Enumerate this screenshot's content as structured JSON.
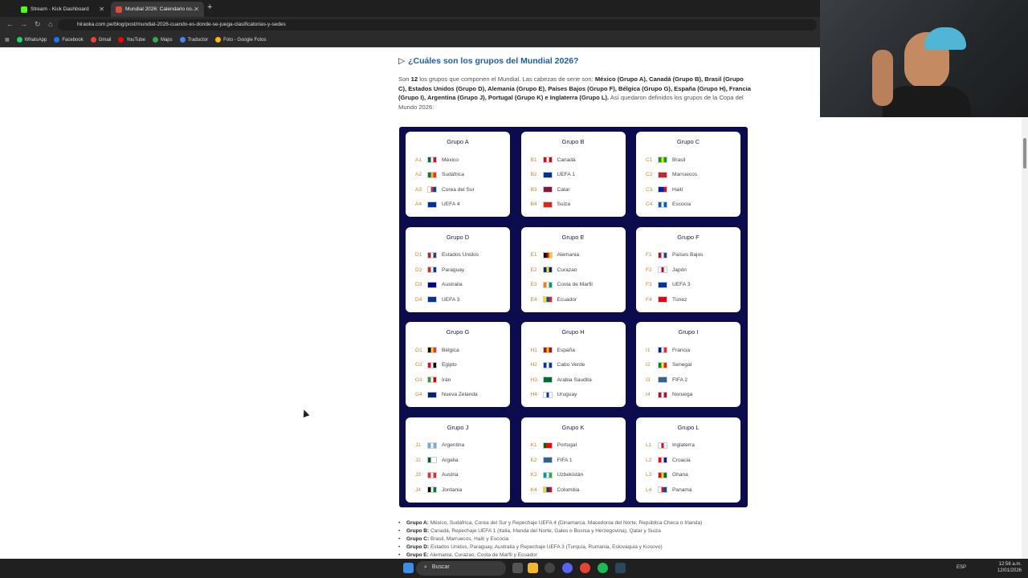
{
  "browser": {
    "tabs": [
      {
        "label": "Stream - Kick Dashboard",
        "active": false,
        "icon": "kick-icon",
        "color": "#53fc18"
      },
      {
        "label": "Mundial 2026: Calendario co...",
        "active": true,
        "icon": "hiraoka-icon",
        "color": "#e04a3b"
      }
    ],
    "new_tab": "+",
    "url": "hiraoka.com.pe/blog/post/mundial-2026-cuando-es-donde-se-juega-clasificatorias-y-sedes",
    "bookmarks": [
      {
        "label": "WhatsApp",
        "color": "#25d366"
      },
      {
        "label": "Facebook",
        "color": "#1877f2"
      },
      {
        "label": "Gmail",
        "color": "#ea4335"
      },
      {
        "label": "YouTube",
        "color": "#ff0000"
      },
      {
        "label": "Maps",
        "color": "#34a853"
      },
      {
        "label": "Traductor",
        "color": "#4285f4"
      },
      {
        "label": "Foto - Google Fotos",
        "color": "#fbbc04"
      }
    ]
  },
  "article": {
    "heading": "¿Cuáles son los grupos del Mundial 2026?",
    "intro": {
      "p1": "Son ",
      "n": "12",
      "p2": " los grupos que componen el Mundial. Las cabezas de serie son: ",
      "seeds": "México (Grupo A), Canadá (Grupo B), Brasil (Grupo C), Estados Unidos (Grupo D), Alemania (Grupo E), Países Bajos (Grupo F), Bélgica (Grupo G), España (Grupo H), Francia (Grupo I), Argentina (Grupo J), Portugal (Grupo K) e Inglaterra (Grupo L).",
      "p3": " Así quedaron definidos los grupos de la Copa del Mundo 2026:"
    },
    "groups": [
      {
        "name": "Grupo A",
        "teams": [
          [
            "A1",
            "México"
          ],
          [
            "A2",
            "Sudáfrica"
          ],
          [
            "A3",
            "Corea del Sur"
          ],
          [
            "A4",
            "UEFA 4"
          ]
        ]
      },
      {
        "name": "Grupo B",
        "teams": [
          [
            "B1",
            "Canadá"
          ],
          [
            "B2",
            "UEFA 1"
          ],
          [
            "B3",
            "Catar"
          ],
          [
            "B4",
            "Suiza"
          ]
        ]
      },
      {
        "name": "Grupo C",
        "teams": [
          [
            "C1",
            "Brasil"
          ],
          [
            "C2",
            "Marruecos"
          ],
          [
            "C3",
            "Haití"
          ],
          [
            "C4",
            "Escocia"
          ]
        ]
      },
      {
        "name": "Grupo D",
        "teams": [
          [
            "D1",
            "Estados Unidos"
          ],
          [
            "D2",
            "Paraguay"
          ],
          [
            "D3",
            "Australia"
          ],
          [
            "D4",
            "UEFA 3"
          ]
        ]
      },
      {
        "name": "Grupo E",
        "teams": [
          [
            "E1",
            "Alemania"
          ],
          [
            "E2",
            "Curazao"
          ],
          [
            "E3",
            "Costa de Marfil"
          ],
          [
            "E4",
            "Ecuador"
          ]
        ]
      },
      {
        "name": "Grupo F",
        "teams": [
          [
            "F1",
            "Países Bajos"
          ],
          [
            "F2",
            "Japón"
          ],
          [
            "F3",
            "UEFA 3"
          ],
          [
            "F4",
            "Túnez"
          ]
        ]
      },
      {
        "name": "Grupo G",
        "teams": [
          [
            "G1",
            "Bélgica"
          ],
          [
            "G2",
            "Egipto"
          ],
          [
            "G3",
            "Irán"
          ],
          [
            "G4",
            "Nueva Zelanda"
          ]
        ]
      },
      {
        "name": "Grupo H",
        "teams": [
          [
            "H1",
            "España"
          ],
          [
            "H2",
            "Cabo Verde"
          ],
          [
            "H3",
            "Arabia Saudita"
          ],
          [
            "H4",
            "Uruguay"
          ]
        ]
      },
      {
        "name": "Grupo I",
        "teams": [
          [
            "I1",
            "Francia"
          ],
          [
            "I2",
            "Senegal"
          ],
          [
            "I3",
            "FIFA 2"
          ],
          [
            "I4",
            "Noruega"
          ]
        ]
      },
      {
        "name": "Grupo J",
        "teams": [
          [
            "J1",
            "Argentina"
          ],
          [
            "J2",
            "Argelia"
          ],
          [
            "J3",
            "Austria"
          ],
          [
            "J4",
            "Jordania"
          ]
        ]
      },
      {
        "name": "Grupo K",
        "teams": [
          [
            "K1",
            "Portugal"
          ],
          [
            "K2",
            "FIFA 1"
          ],
          [
            "K3",
            "Uzbekistán"
          ],
          [
            "K4",
            "Colombia"
          ]
        ]
      },
      {
        "name": "Grupo L",
        "teams": [
          [
            "L1",
            "Inglaterra"
          ],
          [
            "L2",
            "Croacia"
          ],
          [
            "L3",
            "Ghana"
          ],
          [
            "L4",
            "Panamá"
          ]
        ]
      }
    ],
    "notes": [
      {
        "label": "Grupo A:",
        "text": " México, Sudáfrica, Corea del Sur y Repechaje UEFA 4 (Dinamarca, Macedonia del Norte, República Checa o Irlanda)"
      },
      {
        "label": "Grupo B:",
        "text": " Canadá, Repechaje UEFA 1 (Italia, Irlanda del Norte, Gales o Bosnia y Herzegovina), Qatar y Suiza"
      },
      {
        "label": "Grupo C:",
        "text": " Brasil, Marruecos, Haití y Escocia"
      },
      {
        "label": "Grupo D:",
        "text": " Estados Unidos, Paraguay, Australia y Repechaje UEFA 3 (Turquía, Rumania, Eslovaquia y Kosovo)"
      },
      {
        "label": "Grupo E:",
        "text": " Alemania, Curazao, Costa de Marfil y Ecuador"
      }
    ]
  },
  "taskbar": {
    "search_label": "Buscar",
    "lang": "ESP",
    "time": "12:56 a.m.",
    "date": "12/01/2026"
  }
}
